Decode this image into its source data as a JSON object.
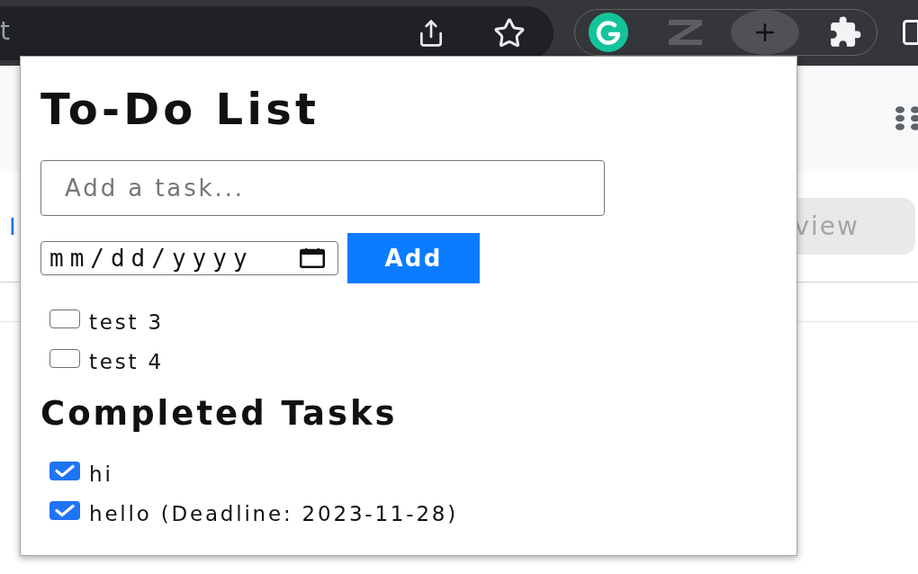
{
  "browser_toolbar": {
    "address_text": "t"
  },
  "page": {
    "link_text": "I",
    "button_text": "view"
  },
  "popup": {
    "title": "To-Do List",
    "task_input": {
      "placeholder": "Add a task..."
    },
    "date_input": {
      "placeholder": "mm/dd/yyyy"
    },
    "add_button": "Add",
    "tasks": [
      {
        "label": "test 3",
        "checked": false
      },
      {
        "label": "test 4",
        "checked": false
      }
    ],
    "completed_heading": "Completed Tasks",
    "completed_tasks": [
      {
        "label": "hi",
        "checked": true
      },
      {
        "label": "hello (Deadline: 2023-11-28)",
        "checked": true
      }
    ]
  }
}
